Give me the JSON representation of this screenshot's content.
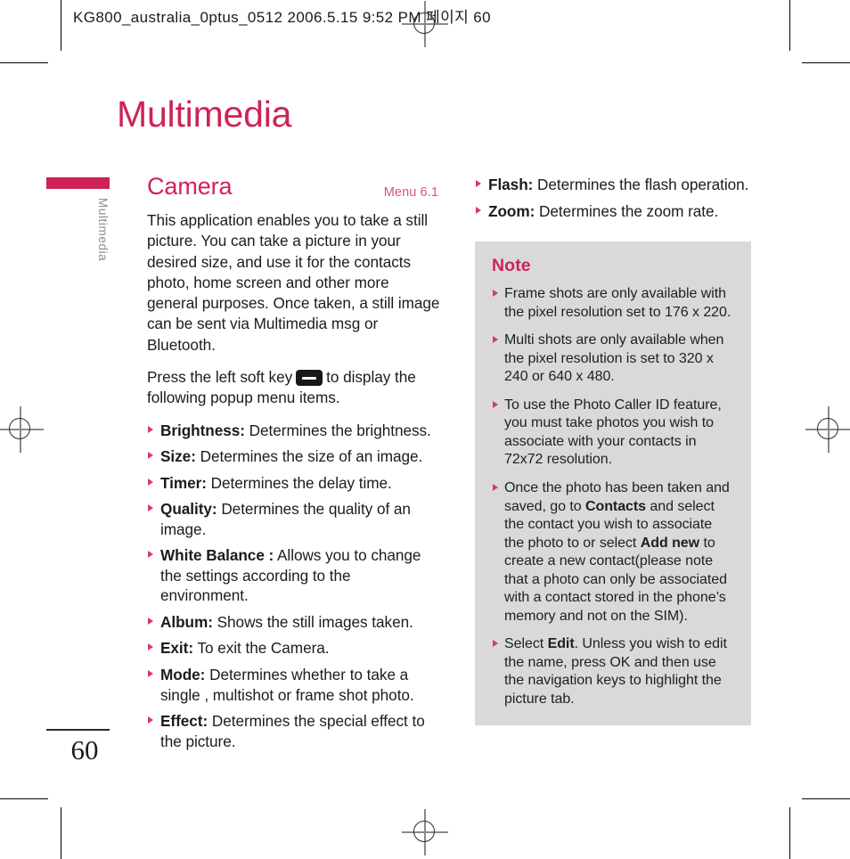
{
  "prepress": {
    "header": "KG800_australia_0ptus_0512 2006.5.15 9:52 PM 페이지 60"
  },
  "chapter": {
    "title": "Multimedia",
    "tab_label": "Multimedia",
    "accent_color": "#ce2356",
    "note_bg_color": "#d9d9d9"
  },
  "section": {
    "title": "Camera",
    "menu_ref": "Menu 6.1",
    "intro": "This application enables you to take a still picture. You can take a picture in your desired size, and use it for the contacts photo, home screen and other more general purposes. Once taken, a still image can be sent via Multimedia msg or Bluetooth.",
    "softkey_sentence_before": "Press the left soft key",
    "softkey_icon": "left-soft-key-icon",
    "softkey_sentence_after": "to display the following popup menu items."
  },
  "menu_items": [
    {
      "term": "Brightness:",
      "desc": "Determines the brightness."
    },
    {
      "term": "Size:",
      "desc": "Determines the size of an image."
    },
    {
      "term": "Timer:",
      "desc": "Determines the delay time."
    },
    {
      "term": "Quality:",
      "desc": "Determines the quality of an image."
    },
    {
      "term": "White Balance :",
      "desc": "Allows you to change the settings according to the environment."
    },
    {
      "term": "Album:",
      "desc": "Shows the still images taken."
    },
    {
      "term": "Exit:",
      "desc": "To exit the Camera."
    },
    {
      "term": "Mode:",
      "desc": "Determines whether to take a single , multishot or frame shot photo."
    },
    {
      "term": "Effect:",
      "desc": "Determines the special effect to the picture."
    },
    {
      "term": "Flash:",
      "desc": "Determines the flash operation."
    },
    {
      "term": "Zoom:",
      "desc": "Determines the zoom rate."
    }
  ],
  "note": {
    "title": "Note",
    "items": [
      {
        "text": "Frame shots are only available with the pixel resolution set to 176 x 220."
      },
      {
        "text": "Multi shots are only available when the pixel resolution is set to 320 x 240 or 640 x 480."
      },
      {
        "text": "To use the Photo Caller ID feature, you must take photos you wish to associate with your contacts in 72x72 resolution."
      },
      {
        "rich": [
          {
            "t": "Once the photo has been taken and saved, go to ",
            "b": false
          },
          {
            "t": "Contacts",
            "b": true
          },
          {
            "t": " and select the contact you wish to associate the photo to or select ",
            "b": false
          },
          {
            "t": "Add new",
            "b": true
          },
          {
            "t": " to create a new contact(please note that a photo can only be associated with a contact stored in the phone’s memory and not on the SIM).",
            "b": false
          }
        ]
      },
      {
        "rich": [
          {
            "t": "Select ",
            "b": false
          },
          {
            "t": "Edit",
            "b": true
          },
          {
            "t": ". Unless you wish to edit the name, press OK and then use the navigation keys to highlight the picture tab.",
            "b": false
          }
        ]
      }
    ]
  },
  "footer": {
    "page_number": "60"
  }
}
